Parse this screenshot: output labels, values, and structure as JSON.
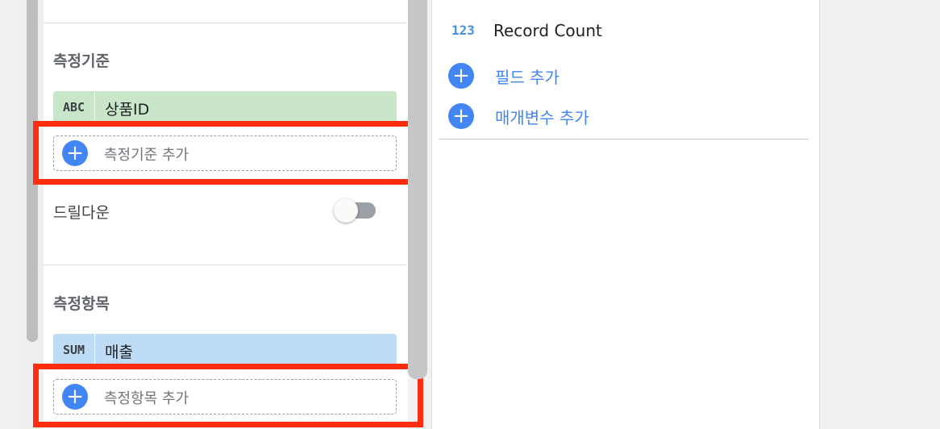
{
  "left_panel": {
    "dimensions": {
      "title": "측정기준",
      "chip": {
        "type": "ABC",
        "label": "상품ID"
      },
      "add_label": "측정기준 추가"
    },
    "drilldown": {
      "label": "드릴다운",
      "enabled": false
    },
    "metrics": {
      "title": "측정항목",
      "chip": {
        "type": "SUM",
        "label": "매출"
      },
      "add_label": "측정항목 추가"
    }
  },
  "right_panel": {
    "field": {
      "type": "123",
      "name": "Record Count"
    },
    "add_field_label": "필드 추가",
    "add_parameter_label": "매개변수 추가"
  },
  "colors": {
    "highlight": "#ff2d0f",
    "accent": "#4285f4",
    "dimension_chip": "#c9e6cb",
    "metric_chip": "#bedcf5"
  },
  "icons": {
    "add": "plus-circle-icon"
  }
}
